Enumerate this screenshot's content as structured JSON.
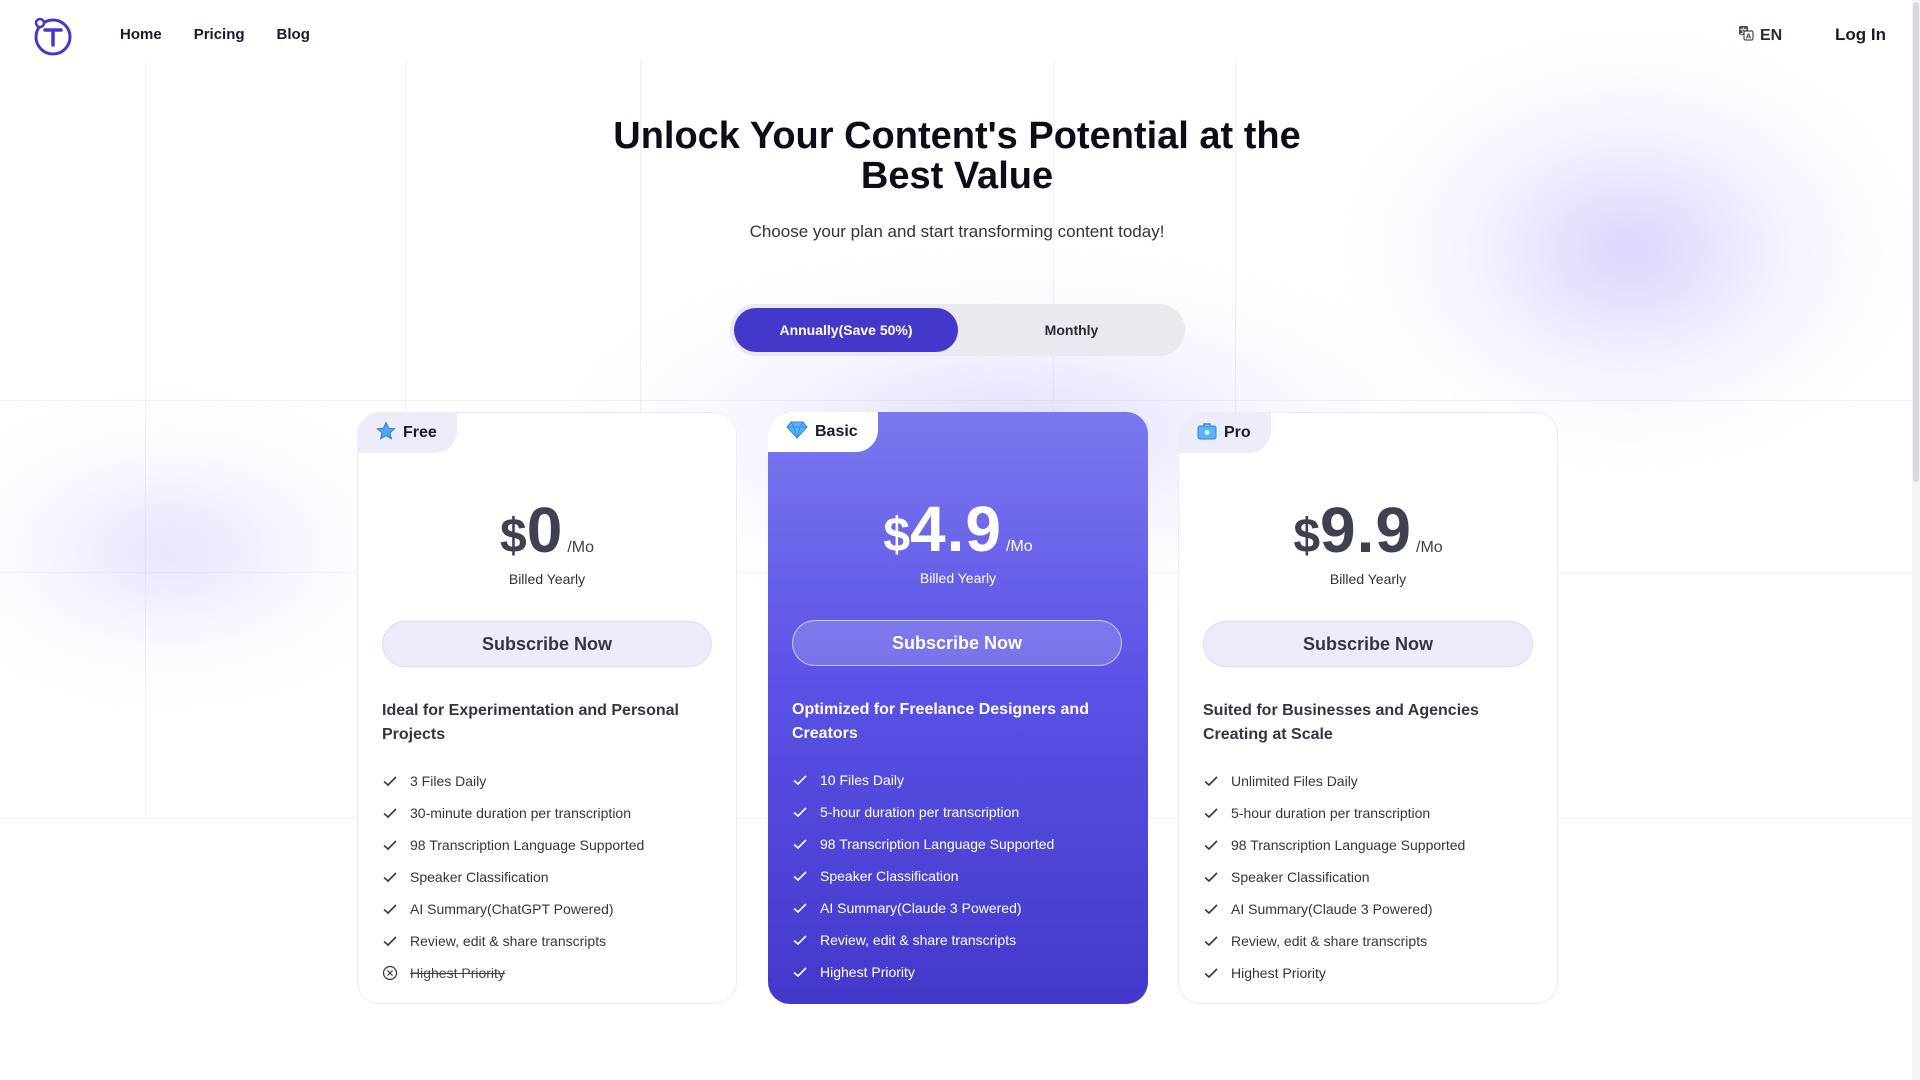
{
  "nav": {
    "logo_icon": "t-logo-icon",
    "links": [
      "Home",
      "Pricing",
      "Blog"
    ],
    "language": "EN",
    "language_icon": "translate-icon",
    "login": "Log In"
  },
  "hero": {
    "title": "Unlock Your Content's Potential at the Best Value",
    "subtitle": "Choose your plan and start transforming content today!"
  },
  "billing_toggle": {
    "options": [
      "Annually(Save 50%)",
      "Monthly"
    ],
    "selected": "Annually(Save 50%)"
  },
  "plans": [
    {
      "name": "Free",
      "icon": "star-icon",
      "currency": "$",
      "amount": "0",
      "period": "/Mo",
      "billing": "Billed Yearly",
      "cta": "Subscribe Now",
      "description": "Ideal for Experimentation and Personal Projects",
      "features": [
        {
          "text": "3 Files Daily",
          "included": true
        },
        {
          "text": "30-minute duration per transcription",
          "included": true
        },
        {
          "text": "98 Transcription Language Supported",
          "included": true
        },
        {
          "text": "Speaker Classification",
          "included": true
        },
        {
          "text": "AI Summary(ChatGPT Powered)",
          "included": true
        },
        {
          "text": "Review, edit & share transcripts",
          "included": true
        },
        {
          "text": "Highest Priority",
          "included": false
        }
      ]
    },
    {
      "name": "Basic",
      "icon": "diamond-icon",
      "currency": "$",
      "amount": "4.9",
      "period": "/Mo",
      "billing": "Billed Yearly",
      "cta": "Subscribe Now",
      "description": "Optimized for Freelance Designers and Creators",
      "features": [
        {
          "text": "10 Files Daily",
          "included": true
        },
        {
          "text": "5-hour duration per transcription",
          "included": true
        },
        {
          "text": "98 Transcription Language Supported",
          "included": true
        },
        {
          "text": "Speaker Classification",
          "included": true
        },
        {
          "text": "AI Summary(Claude 3 Powered)",
          "included": true
        },
        {
          "text": "Review, edit & share transcripts",
          "included": true
        },
        {
          "text": "Highest Priority",
          "included": true
        }
      ]
    },
    {
      "name": "Pro",
      "icon": "briefcase-icon",
      "currency": "$",
      "amount": "9.9",
      "period": "/Mo",
      "billing": "Billed Yearly",
      "cta": "Subscribe Now",
      "description": "Suited for Businesses and Agencies Creating at Scale",
      "features": [
        {
          "text": "Unlimited Files Daily",
          "included": true
        },
        {
          "text": "5-hour duration per transcription",
          "included": true
        },
        {
          "text": "98 Transcription Language Supported",
          "included": true
        },
        {
          "text": "Speaker Classification",
          "included": true
        },
        {
          "text": "AI Summary(Claude 3 Powered)",
          "included": true
        },
        {
          "text": "Review, edit & share transcripts",
          "included": true
        },
        {
          "text": "Highest Priority",
          "included": true
        }
      ]
    }
  ],
  "colors": {
    "accent": "#4338ca",
    "featured_gradient_top": "#7a78ee",
    "featured_gradient_bottom": "#4338ca",
    "text_dark": "#1a1a2e"
  }
}
